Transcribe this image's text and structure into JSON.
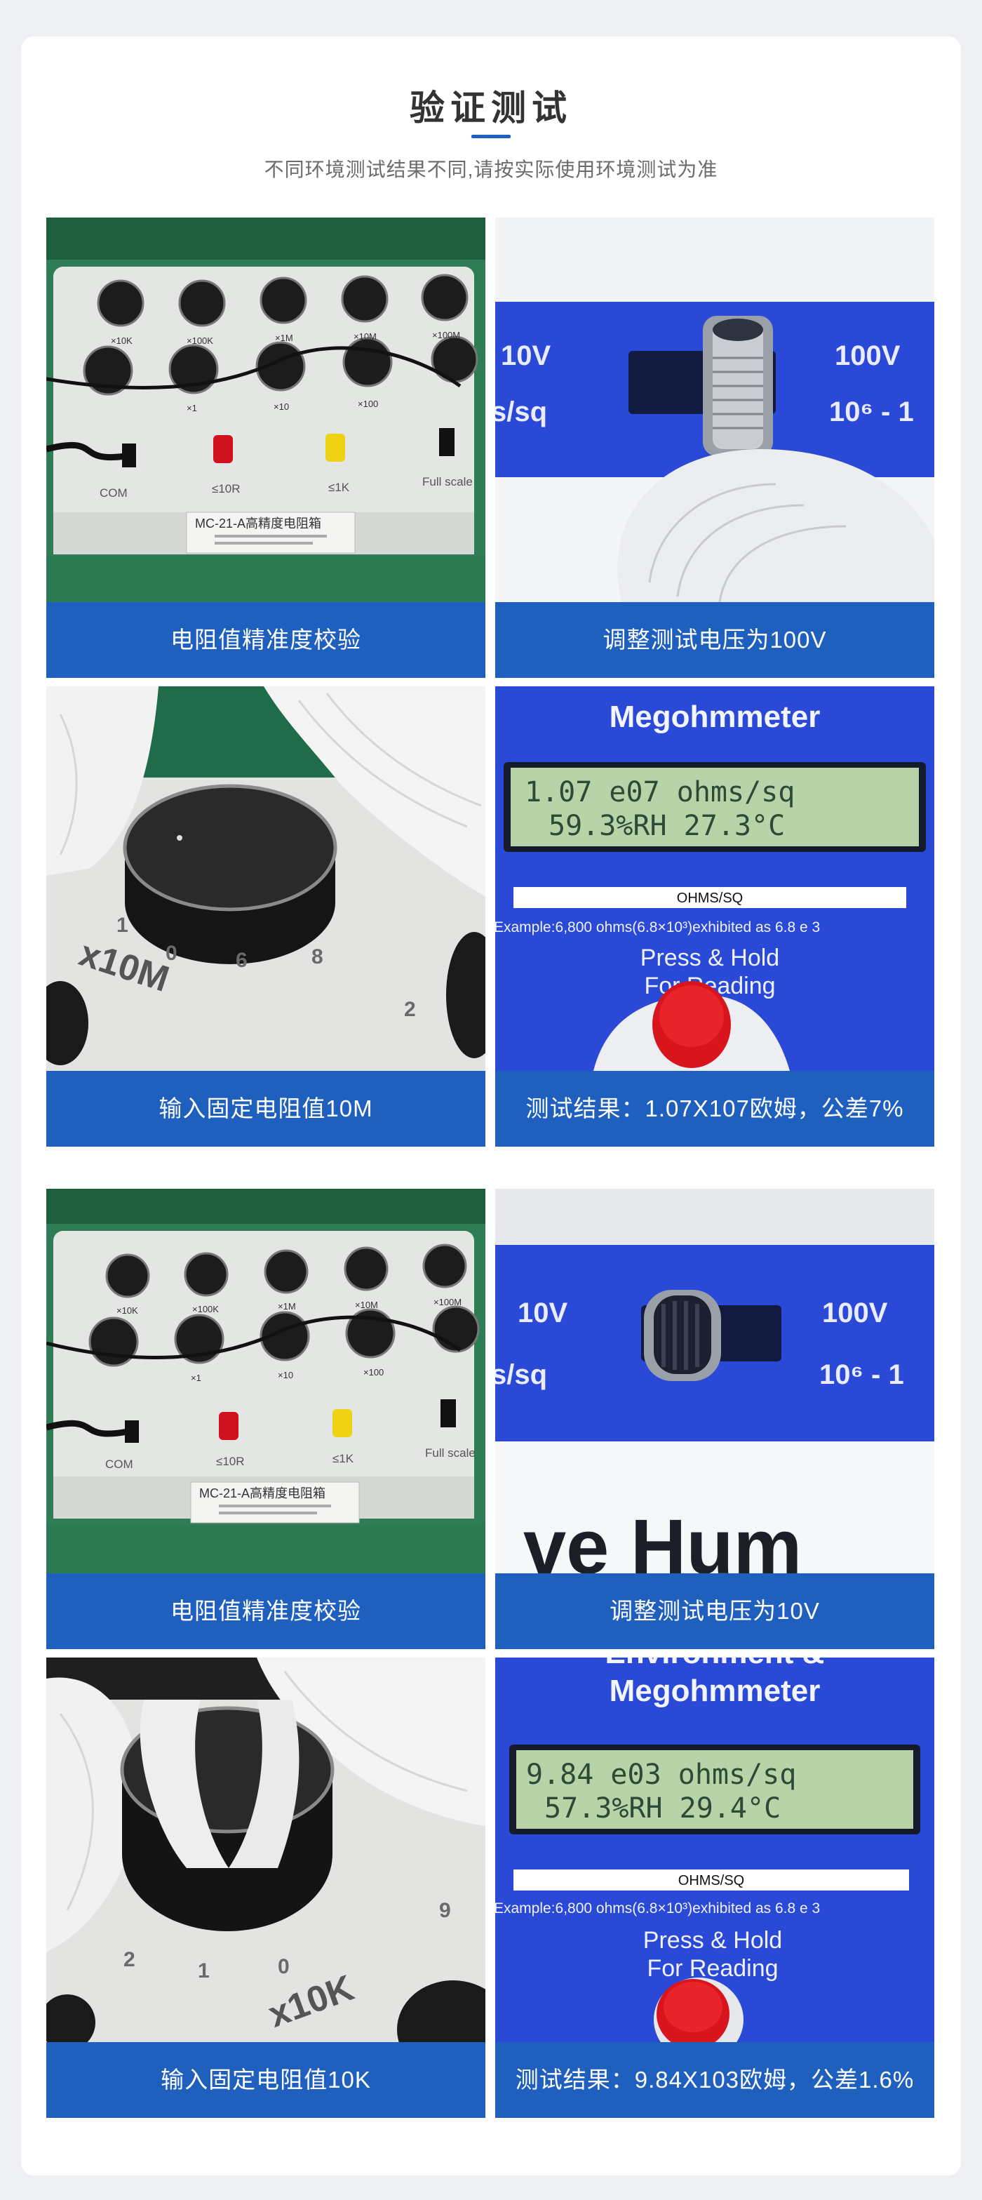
{
  "header": {
    "title": "验证测试",
    "subtitle": "不同环境测试结果不同,请按实际使用环境测试为准"
  },
  "groups": [
    {
      "tiles": [
        {
          "caption": "电阻值精准度校验",
          "photo": {
            "box_label": "MC-21-A高精度电阻箱",
            "knob_labels": [
              "×10K",
              "×100K",
              "×1M",
              "×10M",
              "×100M",
              "×1",
              "×10",
              "×100"
            ],
            "jack_labels": [
              "COM",
              "≤10R",
              "≤1K",
              "Full scale"
            ]
          }
        },
        {
          "caption": "调整测试电压为100V",
          "photo": {
            "left_label": "10V",
            "right_label": "100V",
            "left_label2": "s/sq",
            "right_label2": "10⁶ - 1"
          }
        },
        {
          "caption": "输入固定电阻值10M",
          "photo": {
            "dial_label": "x10M",
            "dial_digits": [
              "0",
              "6",
              "8",
              "1",
              "2"
            ]
          }
        },
        {
          "caption": "测试结果：1.07X107欧姆，公差7%",
          "photo": {
            "brand_top": "",
            "brand": "Megohmmeter",
            "lcd_line1": "1.07 e07 ohms/sq",
            "lcd_line2": "59.3%RH   27.3°C",
            "unit_tag": "OHMS/SQ",
            "example": "Example:6,800 ohms(6.8×10³)exhibited as 6.8 e 3",
            "press": "Press & Hold",
            "for_reading": "For Reading"
          }
        }
      ]
    },
    {
      "tiles": [
        {
          "caption": "电阻值精准度校验",
          "photo": {
            "box_label": "MC-21-A高精度电阻箱",
            "knob_labels": [
              "×10K",
              "×100K",
              "×1M",
              "×10M",
              "×100M",
              "×1",
              "×10",
              "×100"
            ],
            "jack_labels": [
              "COM",
              "≤10R",
              "≤1K",
              "Full scale"
            ]
          }
        },
        {
          "caption": "调整测试电压为10V",
          "photo": {
            "left_label": "10V",
            "right_label": "100V",
            "left_label2": "s/sq",
            "right_label2": "10⁶ - 1",
            "bottom_text": "ve Hum"
          }
        },
        {
          "caption": "输入固定电阻值10K",
          "photo": {
            "dial_label": "x10K",
            "dial_digits": [
              "0",
              "1",
              "2",
              "9"
            ]
          }
        },
        {
          "caption": "测试结果：9.84X103欧姆，公差1.6%",
          "photo": {
            "brand_top": "Environment &",
            "brand": "Megohmmeter",
            "lcd_line1": "9.84 e03 ohms/sq",
            "lcd_line2": "57.3%RH   29.4°C",
            "unit_tag": "OHMS/SQ",
            "example": "Example:6,800 ohms(6.8×10³)exhibited as 6.8 e 3",
            "press": "Press & Hold",
            "for_reading": "For Reading"
          }
        }
      ]
    }
  ],
  "colors": {
    "accent": "#1f5fbd",
    "meter_blue": "#2a49d6",
    "lcd": "#b9d3a8"
  }
}
